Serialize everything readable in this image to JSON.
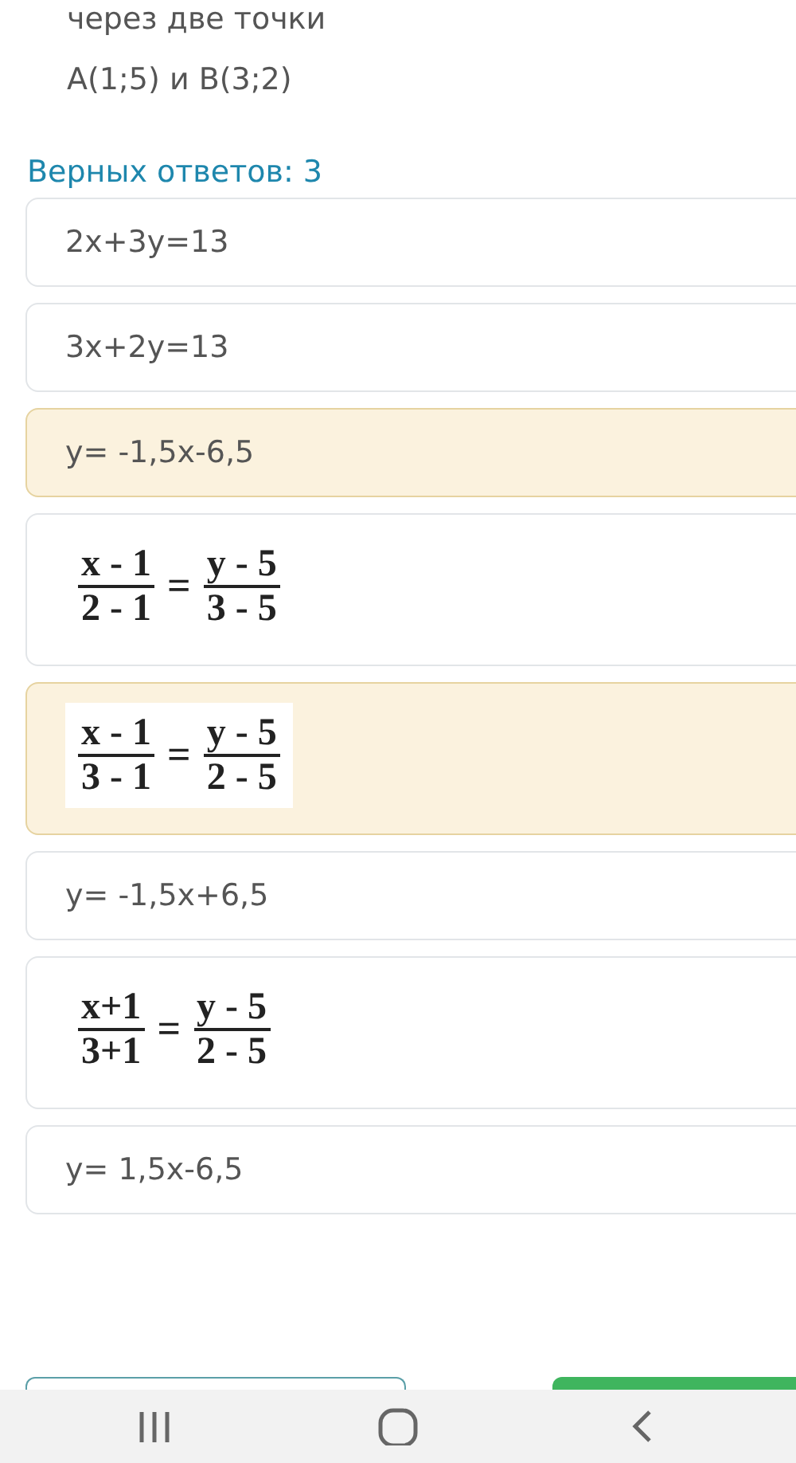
{
  "question": {
    "lines": [
      "через две точки",
      "A(1;5) и B(3;2)"
    ]
  },
  "answers_header": "Верных ответов: 3",
  "options": [
    {
      "kind": "text",
      "text": "2x+3y=13",
      "selected": false
    },
    {
      "kind": "text",
      "text": "3x+2y=13",
      "selected": false
    },
    {
      "kind": "text",
      "text": "y= -1,5x-6,5",
      "selected": true
    },
    {
      "kind": "fraction",
      "left_num": "x - 1",
      "left_den": "2 - 1",
      "sign": "=",
      "right_num": "y - 5",
      "right_den": "3 - 5",
      "selected": false
    },
    {
      "kind": "fraction",
      "left_num": "x - 1",
      "left_den": "3 - 1",
      "sign": "=",
      "right_num": "y - 5",
      "right_den": "2 - 5",
      "selected": true
    },
    {
      "kind": "text",
      "text": "y= -1,5x+6,5",
      "selected": false
    },
    {
      "kind": "fraction",
      "left_num": "x+1",
      "left_den": "3+1",
      "sign": "=",
      "right_num": "y - 5",
      "right_den": "2 - 5",
      "selected": false
    },
    {
      "kind": "text",
      "text": "y= 1,5x-6,5",
      "selected": false
    }
  ],
  "nav_bar": {
    "buttons": [
      {
        "kind": "recents"
      },
      {
        "kind": "home"
      },
      {
        "kind": "back"
      }
    ]
  }
}
